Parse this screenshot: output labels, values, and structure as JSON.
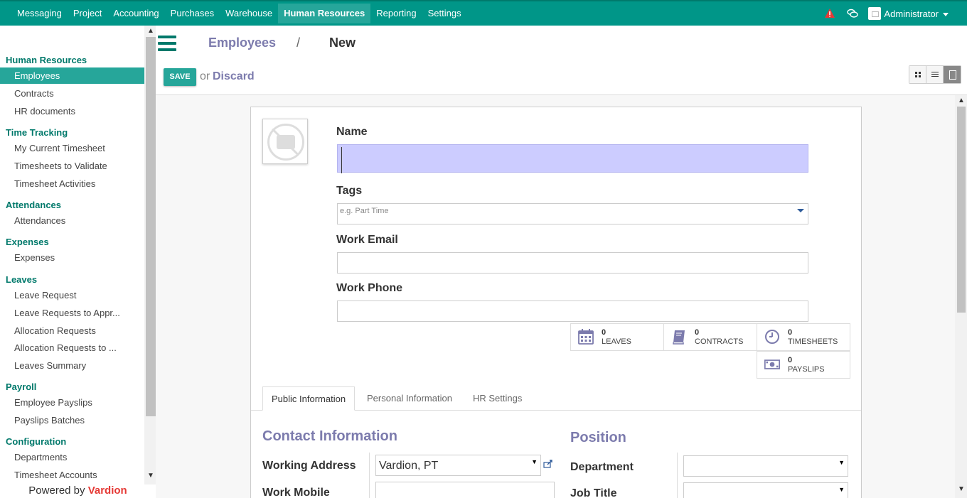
{
  "topbar": {
    "menu": [
      "Messaging",
      "Project",
      "Accounting",
      "Purchases",
      "Warehouse",
      "Human Resources",
      "Reporting",
      "Settings"
    ],
    "active": "Human Resources",
    "user": "Administrator",
    "alert_icon": "warning-icon",
    "chat_icon": "chat-icon",
    "color": "#009688"
  },
  "sidebar": {
    "sections": [
      {
        "title": "Human Resources",
        "items": [
          "Employees",
          "Contracts",
          "HR documents"
        ]
      },
      {
        "title": "Time Tracking",
        "items": [
          "My Current Timesheet",
          "Timesheets to Validate",
          "Timesheet Activities"
        ]
      },
      {
        "title": "Attendances",
        "items": [
          "Attendances"
        ]
      },
      {
        "title": "Expenses",
        "items": [
          "Expenses"
        ]
      },
      {
        "title": "Leaves",
        "items": [
          "Leave Request",
          "Leave Requests to Appr...",
          "Allocation Requests",
          "Allocation Requests to ...",
          "Leaves Summary"
        ]
      },
      {
        "title": "Payroll",
        "items": [
          "Employee Payslips",
          "Payslips Batches"
        ]
      },
      {
        "title": "Configuration",
        "items": [
          "Departments",
          "Timesheet Accounts"
        ]
      }
    ],
    "active_item": "Employees",
    "powered_prefix": "Powered by ",
    "powered_brand": "Vardion"
  },
  "control": {
    "breadcrumb_link": "Employees",
    "breadcrumb_sep": "/",
    "breadcrumb_current": "New",
    "save": "SAVE",
    "or": "or",
    "discard": "Discard"
  },
  "form": {
    "name_label": "Name",
    "name_value": "",
    "tags_label": "Tags",
    "tags_placeholder": "e.g. Part Time",
    "work_email_label": "Work Email",
    "work_email_value": "",
    "work_phone_label": "Work Phone",
    "work_phone_value": "",
    "stats": [
      {
        "value": "0",
        "label": "LEAVES",
        "icon": "calendar-icon"
      },
      {
        "value": "0",
        "label": "CONTRACTS",
        "icon": "book-icon"
      },
      {
        "value": "0",
        "label": "TIMESHEETS",
        "icon": "clock-icon"
      },
      {
        "value": "0",
        "label": "PAYSLIPS",
        "icon": "money-icon"
      }
    ],
    "tabs": [
      "Public Information",
      "Personal Information",
      "HR Settings"
    ],
    "active_tab": "Public Information",
    "contact_heading": "Contact Information",
    "working_address_label": "Working Address",
    "working_address_value": "Vardion, PT",
    "work_mobile_label": "Work Mobile",
    "position_heading": "Position",
    "department_label": "Department",
    "job_title_label": "Job Title"
  }
}
